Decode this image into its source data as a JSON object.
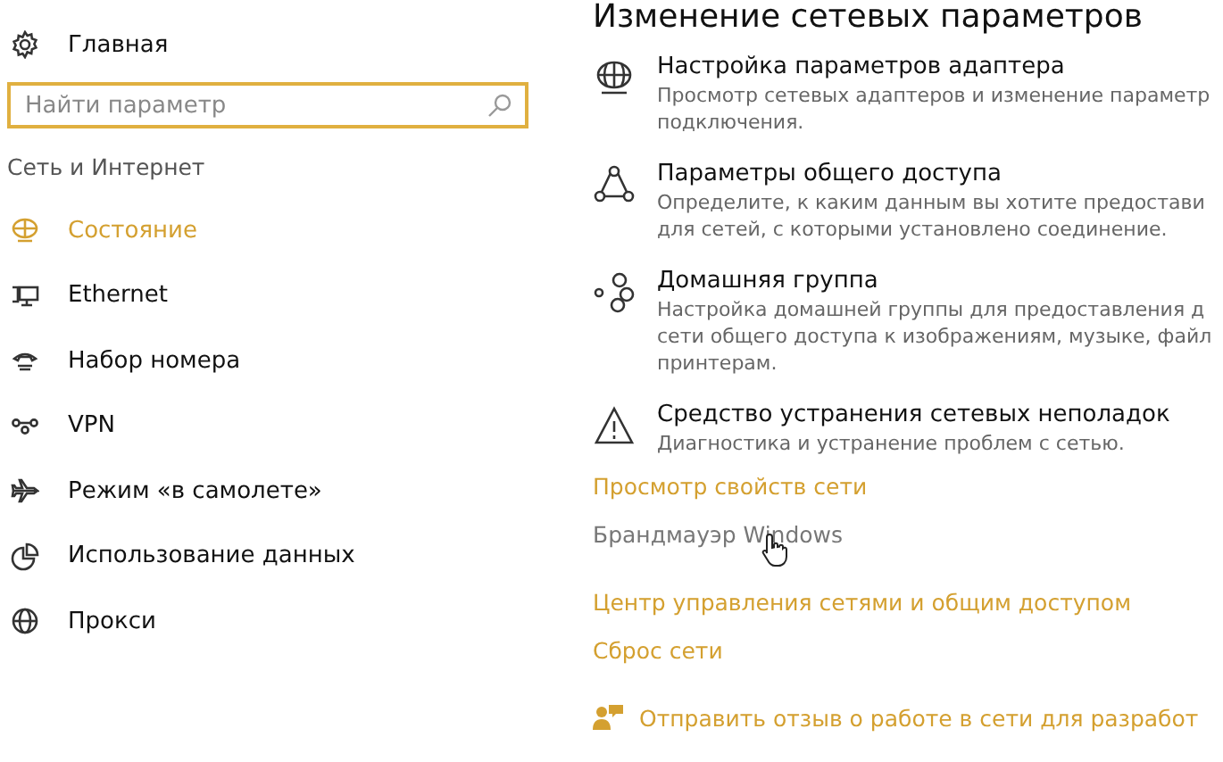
{
  "sidebar": {
    "home": {
      "label": "Главная"
    },
    "search": {
      "placeholder": "Найти параметр"
    },
    "section": "Сеть и Интернет",
    "items": [
      {
        "kind": "status",
        "label": "Состояние",
        "selected": true
      },
      {
        "kind": "ethernet",
        "label": "Ethernet",
        "selected": false
      },
      {
        "kind": "dialup",
        "label": "Набор номера",
        "selected": false
      },
      {
        "kind": "vpn",
        "label": "VPN",
        "selected": false
      },
      {
        "kind": "airplane",
        "label": "Режим «в самолете»",
        "selected": false
      },
      {
        "kind": "data",
        "label": "Использование данных",
        "selected": false
      },
      {
        "kind": "proxy",
        "label": "Прокси",
        "selected": false
      }
    ]
  },
  "content": {
    "title": "Изменение сетевых параметров",
    "options": [
      {
        "kind": "adapter",
        "title": "Настройка параметров адаптера",
        "description": "Просмотр сетевых адаптеров и изменение параметр\nподключения."
      },
      {
        "kind": "sharing",
        "title": "Параметры общего доступа",
        "description": "Определите, к каким данным вы хотите предостави\nдля сетей, с которыми установлено соединение."
      },
      {
        "kind": "homegroup",
        "title": "Домашняя группа",
        "description": "Настройка домашней группы для предоставления д\nсети общего доступа к изображениям, музыке, файл\nпринтерам."
      },
      {
        "kind": "troubleshoot",
        "title": "Средство устранения сетевых неполадок",
        "description": "Диагностика и устранение проблем с сетью."
      }
    ],
    "links": [
      {
        "label": "Просмотр свойств сети",
        "hovered": false
      },
      {
        "label": "Брандмауэр Windows",
        "hovered": true
      },
      {
        "label": "Центр управления сетями и общим доступом",
        "hovered": false
      },
      {
        "label": "Сброс сети",
        "hovered": false
      }
    ],
    "feedback": {
      "label": "Отправить отзыв о работе в сети для разработ"
    }
  }
}
